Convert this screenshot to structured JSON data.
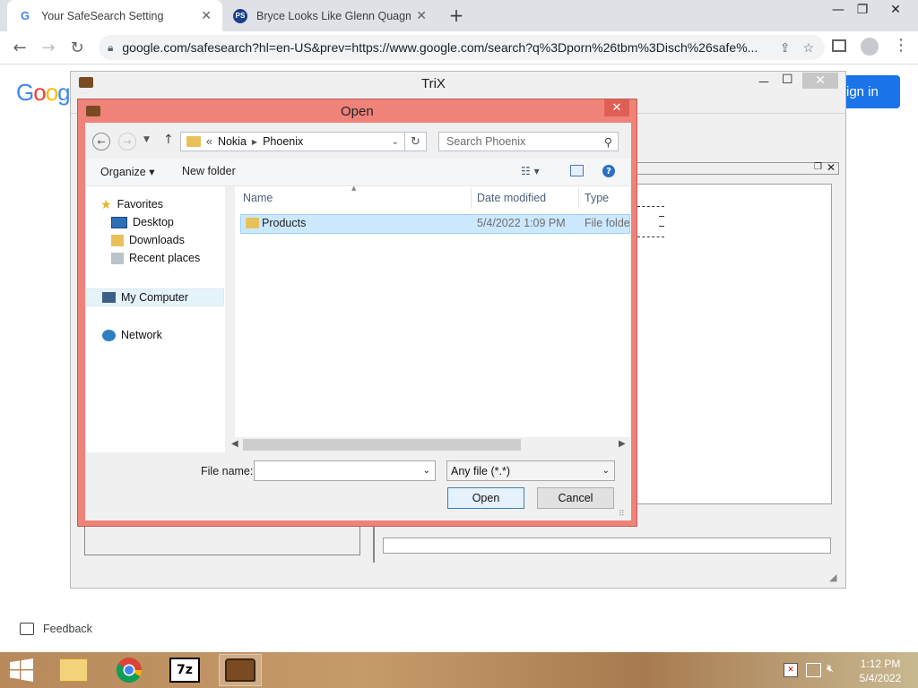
{
  "browser": {
    "tabs": [
      {
        "favicon": "G",
        "title": "Your SafeSearch Setting",
        "active": true
      },
      {
        "favicon": "PS",
        "title": "Bryce Looks Like Glenn Quagmire",
        "active": false
      }
    ],
    "new_tab": "+",
    "url": "google.com/safesearch?hl=en-US&prev=https://www.google.com/search?q%3Dporn%26tbm%3Disch%26safe%...",
    "window_controls": {
      "minimize": "—",
      "restore": "❐",
      "close": "✕"
    }
  },
  "google_page": {
    "logo_text": "Goog",
    "sign_in_label": "ign in",
    "feedback_label": "Feedback"
  },
  "trix": {
    "title": "TriX",
    "controls": {
      "minimize": "—",
      "maximize": "☐",
      "close": "✕"
    }
  },
  "open_dialog": {
    "title": "Open",
    "breadcrumb": [
      "«",
      "Nokia",
      "Phoenix"
    ],
    "search_placeholder": "Search Phoenix",
    "organize_label": "Organize ▾",
    "new_folder_label": "New folder",
    "nav": {
      "favorites_label": "Favorites",
      "favorites_items": [
        "Desktop",
        "Downloads",
        "Recent places"
      ],
      "computer_label": "My Computer",
      "network_label": "Network"
    },
    "columns": [
      "Name",
      "Date modified",
      "Type"
    ],
    "files": [
      {
        "name": "Products",
        "date_modified": "5/4/2022 1:09 PM",
        "type": "File folder"
      }
    ],
    "file_name_label": "File name:",
    "file_name_value": "",
    "file_type_value": "Any file (*.*)",
    "open_label": "Open",
    "cancel_label": "Cancel"
  },
  "taskbar": {
    "time": "1:12 PM",
    "date": "5/4/2022",
    "apps": [
      "start-button",
      "file-explorer",
      "chrome",
      "7-zip",
      "trix"
    ]
  },
  "colors": {
    "dialog_frame": "#ef8379",
    "selection": "#cce8ff",
    "chrome_tabstrip": "#dee1e6",
    "google_blue": "#1a73e8"
  }
}
